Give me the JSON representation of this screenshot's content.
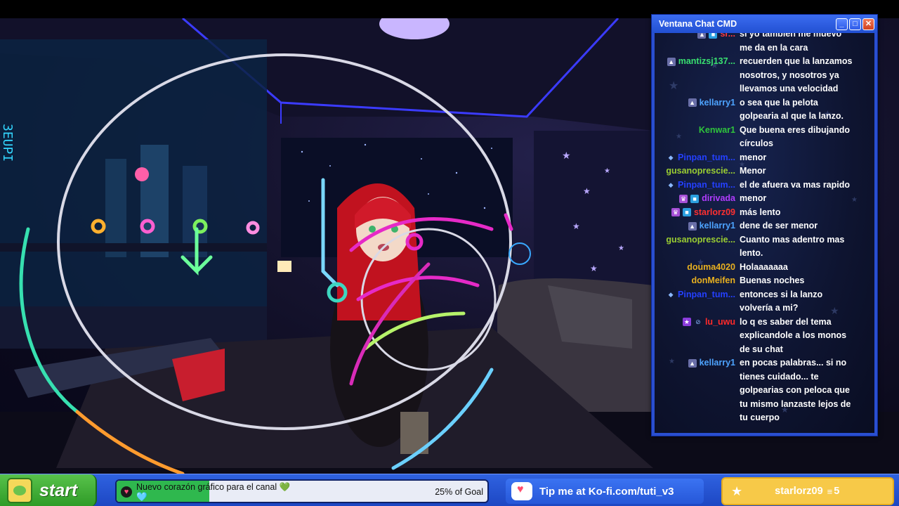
{
  "chat": {
    "title": "Ventana Chat CMD",
    "buttons": {
      "minimize": "_",
      "maximize": "□",
      "close": "✕"
    },
    "messages": [
      {
        "user": "sr...",
        "color": "#ff3b3b",
        "badges": [
          "mod",
          "sub"
        ],
        "text": "si yo también me muevo"
      },
      {
        "user": "",
        "color": "#ffffff",
        "badges": [],
        "text": "me da en la cara"
      },
      {
        "user": "mantizsj137...",
        "color": "#39e070",
        "badges": [
          "mod"
        ],
        "text": "recuerden que la lanzamos"
      },
      {
        "user": "",
        "color": "#ffffff",
        "badges": [],
        "text": "nosotros, y nosotros ya"
      },
      {
        "user": "",
        "color": "#ffffff",
        "badges": [],
        "text": "llevamos una velocidad"
      },
      {
        "user": "kellarry1",
        "color": "#4da3ff",
        "badges": [
          "mod"
        ],
        "text": "o sea que la pelota"
      },
      {
        "user": "",
        "color": "#ffffff",
        "badges": [],
        "text": "golpearia al que la lanzo."
      },
      {
        "user": "Kenwar1",
        "color": "#2fc43c",
        "badges": [],
        "text": "Que buena eres dibujando"
      },
      {
        "user": "",
        "color": "#ffffff",
        "badges": [],
        "text": "círculos"
      },
      {
        "user": "Pinpan_tum...",
        "color": "#2440ff",
        "badges": [
          "diamond"
        ],
        "text": "menor"
      },
      {
        "user": "gusanoprescie...",
        "color": "#9acd32",
        "badges": [],
        "text": "Menor"
      },
      {
        "user": "Pinpan_tum...",
        "color": "#2440ff",
        "badges": [
          "diamond"
        ],
        "text": "el de afuera va mas rapido"
      },
      {
        "user": "dirivada",
        "color": "#b23cff",
        "badges": [
          "vip",
          "sub"
        ],
        "text": "menor"
      },
      {
        "user": "starlorz09",
        "color": "#ff3030",
        "badges": [
          "vip",
          "sub"
        ],
        "text": "más lento"
      },
      {
        "user": "kellarry1",
        "color": "#4da3ff",
        "badges": [
          "mod"
        ],
        "text": "dene de ser menor"
      },
      {
        "user": "gusanoprescie...",
        "color": "#9acd32",
        "badges": [],
        "text": "Cuanto mas adentro mas"
      },
      {
        "user": "",
        "color": "#ffffff",
        "badges": [],
        "text": "lento."
      },
      {
        "user": "douma4020",
        "color": "#e8b020",
        "badges": [],
        "text": "Holaaaaaaa"
      },
      {
        "user": "donMeifen",
        "color": "#e8b020",
        "badges": [],
        "text": "Buenas noches"
      },
      {
        "user": "Pinpan_tum...",
        "color": "#2440ff",
        "badges": [
          "diamond"
        ],
        "text": "entonces si la lanzo"
      },
      {
        "user": "",
        "color": "#ffffff",
        "badges": [],
        "text": "volvería a mi?"
      },
      {
        "user": "lu_uwu",
        "color": "#ff2a2a",
        "badges": [
          "star",
          "mute"
        ],
        "text": "lo q es saber del tema"
      },
      {
        "user": "",
        "color": "#ffffff",
        "badges": [],
        "text": "explicandole a los monos"
      },
      {
        "user": "",
        "color": "#ffffff",
        "badges": [],
        "text": "de su chat"
      },
      {
        "user": "kellarry1",
        "color": "#4da3ff",
        "badges": [
          "mod"
        ],
        "text": "en pocas palabras... si no"
      },
      {
        "user": "",
        "color": "#ffffff",
        "badges": [],
        "text": "tienes cuidado... te"
      },
      {
        "user": "",
        "color": "#ffffff",
        "badges": [],
        "text": "golpearias con peloca que"
      },
      {
        "user": "",
        "color": "#ffffff",
        "badges": [],
        "text": "tu mismo lanzaste lejos de"
      },
      {
        "user": "",
        "color": "#ffffff",
        "badges": [],
        "text": "tu cuerpo"
      }
    ]
  },
  "taskbar": {
    "start_label": "start",
    "goal_text": "Nuevo corazón gráfico para el canal 💚🩵",
    "goal_percent_label": "25% of Goal",
    "goal_fraction": 0.25,
    "kofi_text": "Tip me at Ko-fi.com/tuti_v3",
    "latest_sub_name": "starlorz09",
    "latest_sub_count": "5"
  },
  "colors": {
    "chat_frame": "#2a4fd0",
    "taskbar": "#2f62e0",
    "start_green": "#3fae34",
    "goal_fill": "#2fb84e",
    "sub_yellow": "#f7c948"
  }
}
